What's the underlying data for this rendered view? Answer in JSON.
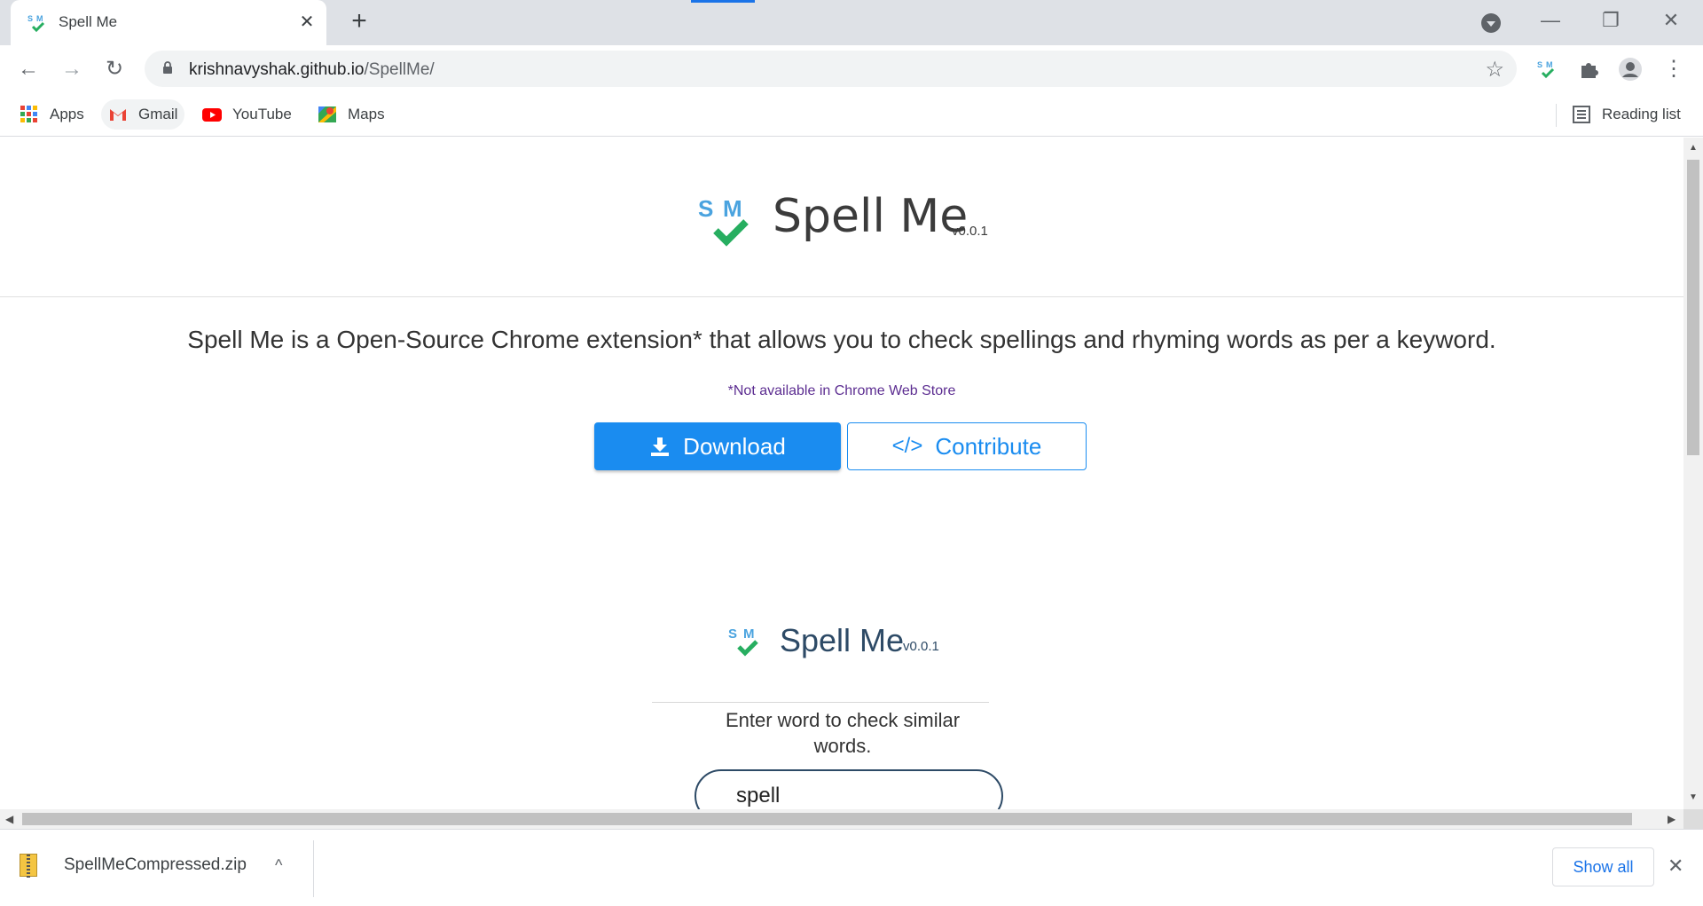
{
  "tab": {
    "title": "Spell Me",
    "close_glyph": "✕",
    "new_glyph": "+"
  },
  "window": {
    "minimize": "—",
    "restore": "❐",
    "close": "✕"
  },
  "nav": {
    "back": "←",
    "forward": "→",
    "reload": "↻"
  },
  "omnibox": {
    "domain": "krishnavyshak.github.io",
    "path": "/SpellMe/",
    "star": "☆"
  },
  "toolbar": {
    "menu": "⋮"
  },
  "bookmarks": {
    "apps": "Apps",
    "gmail": "Gmail",
    "youtube": "YouTube",
    "maps": "Maps",
    "reading_list": "Reading list"
  },
  "hero": {
    "logo_letters": "S M",
    "title": "Spell Me",
    "version": "v0.0.1"
  },
  "tagline": "Spell Me is a Open-Source Chrome extension* that allows you to check spellings and rhyming words as per a keyword.",
  "note": "*Not available in Chrome Web Store",
  "buttons": {
    "download": "Download",
    "contribute": "Contribute",
    "code_glyph": "</>"
  },
  "demo": {
    "title": "Spell Me",
    "version": "v0.0.1",
    "hint": "Enter word to check similar words.",
    "input_value": "spell"
  },
  "downloads": {
    "file": "SpellMeCompressed.zip",
    "caret": "^",
    "show_all": "Show all",
    "close": "✕"
  },
  "colors": {
    "accent": "#1a8cf0",
    "brand_blue": "#4aa3df",
    "brand_green": "#27ae60",
    "note_purple": "#5c2d91"
  }
}
